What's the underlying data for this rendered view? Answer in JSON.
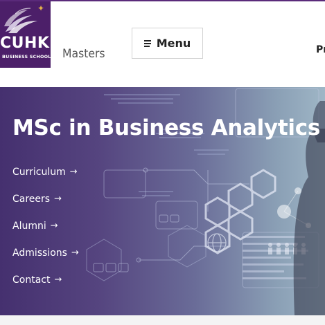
{
  "header": {
    "logo_text": "CUHK",
    "logo_subtext": "BUSINESS SCHOOL",
    "section_label": "Masters",
    "menu_label": "Menu",
    "truncated_text": "Pr"
  },
  "hero": {
    "title": "MSc in Business Analytics",
    "links": [
      {
        "label": "Curriculum",
        "arrow": "→"
      },
      {
        "label": "Careers",
        "arrow": "→"
      },
      {
        "label": "Alumni",
        "arrow": "→"
      },
      {
        "label": "Admissions",
        "arrow": "→"
      },
      {
        "label": "Contact",
        "arrow": "→"
      }
    ]
  },
  "colors": {
    "brand_purple": "#4c1f69",
    "logo_star": "#e3b34a",
    "hero_overlay_left": "#45306f",
    "hero_overlay_right": "#9fb6c6"
  },
  "icons": {
    "logo_mark": "swirl-emblem-icon",
    "menu": "hamburger-icon",
    "link_arrow": "arrow-right-icon"
  }
}
